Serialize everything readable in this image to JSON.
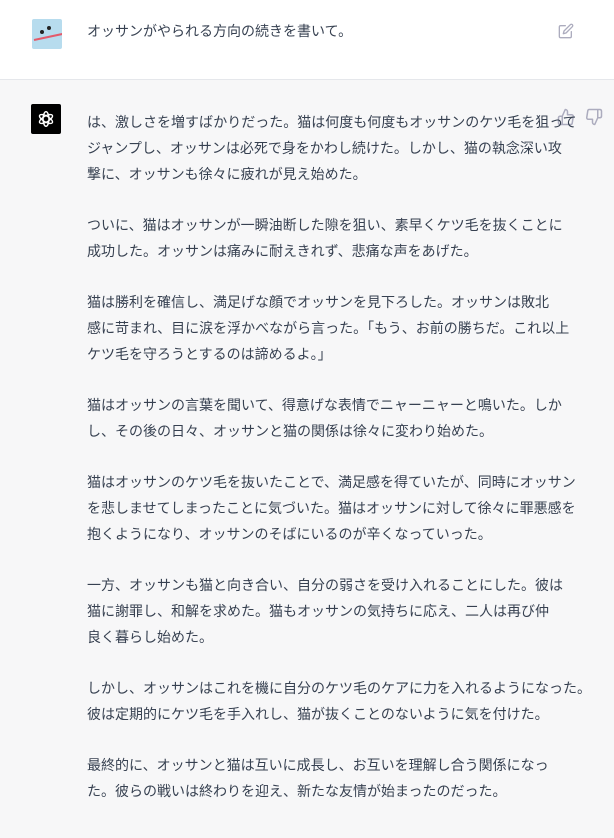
{
  "user_message": {
    "text": "オッサンがやられる方向の続きを書いて。",
    "avatar_icon": "user-avatar-icon",
    "edit_icon": "edit-icon"
  },
  "assistant_message": {
    "avatar_icon": "openai-logo-icon",
    "feedback_icons": [
      "thumbs-up-icon",
      "thumbs-down-icon"
    ],
    "paragraphs": [
      [
        "は、激しさを増すばかりだった。猫は何度も何度もオッサンのケツ毛を狙って",
        "ジャンプし、オッサンは必死で身をかわし続けた。しかし、猫の執念深い攻",
        "撃に、オッサンも徐々に疲れが見え始めた。"
      ],
      [
        "ついに、猫はオッサンが一瞬油断した隙を狙い、素早くケツ毛を抜くことに",
        "成功した。オッサンは痛みに耐えきれず、悲痛な声をあげた。"
      ],
      [
        "猫は勝利を確信し、満足げな顔でオッサンを見下ろした。オッサンは敗北",
        "感に苛まれ、目に涙を浮かべながら言った。「もう、お前の勝ちだ。これ以上",
        "ケツ毛を守ろうとするのは諦めるよ。」"
      ],
      [
        "猫はオッサンの言葉を聞いて、得意げな表情でニャーニャーと鳴いた。しか",
        "し、その後の日々、オッサンと猫の関係は徐々に変わり始めた。"
      ],
      [
        "猫はオッサンのケツ毛を抜いたことで、満足感を得ていたが、同時にオッサン",
        "を悲しませてしまったことに気づいた。猫はオッサンに対して徐々に罪悪感を",
        "抱くようになり、オッサンのそばにいるのが辛くなっていった。"
      ],
      [
        "一方、オッサンも猫と向き合い、自分の弱さを受け入れることにした。彼は",
        "猫に謝罪し、和解を求めた。猫もオッサンの気持ちに応え、二人は再び仲",
        "良く暮らし始めた。"
      ],
      [
        "しかし、オッサンはこれを機に自分のケツ毛のケアに力を入れるようになった。",
        "彼は定期的にケツ毛を手入れし、猫が抜くことのないように気を付けた。"
      ],
      [
        "最終的に、オッサンと猫は互いに成長し、お互いを理解し合う関係になっ",
        "た。彼らの戦いは終わりを迎え、新たな友情が始まったのだった。"
      ]
    ]
  },
  "colors": {
    "user_bg": "#ffffff",
    "assistant_bg": "#f7f7f8",
    "text": "#374151",
    "icon": "#acacbe",
    "border": "#e5e7eb"
  }
}
